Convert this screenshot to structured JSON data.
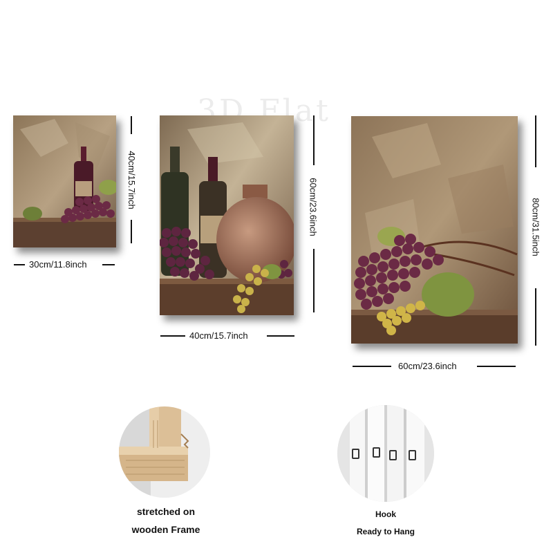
{
  "watermark": "3D Flat",
  "panels": [
    {
      "id": "small",
      "width_label": "30cm/11.8inch",
      "height_label": "40cm/15.7inch"
    },
    {
      "id": "medium",
      "width_label": "40cm/15.7inch",
      "height_label": "60cm/23.6inch"
    },
    {
      "id": "large",
      "width_label": "60cm/23.6inch",
      "height_label": "80cm/31.5inch"
    }
  ],
  "features": {
    "frame": {
      "caption_line1": "stretched on",
      "caption_line2": "wooden Frame"
    },
    "hook": {
      "caption_line1": "Hook",
      "caption_line2": "Ready to Hang"
    }
  },
  "colors": {
    "wall": "#9a8466",
    "grape": "#6b2a45",
    "leaf": "#7f9440",
    "wood": "#d9b990"
  }
}
